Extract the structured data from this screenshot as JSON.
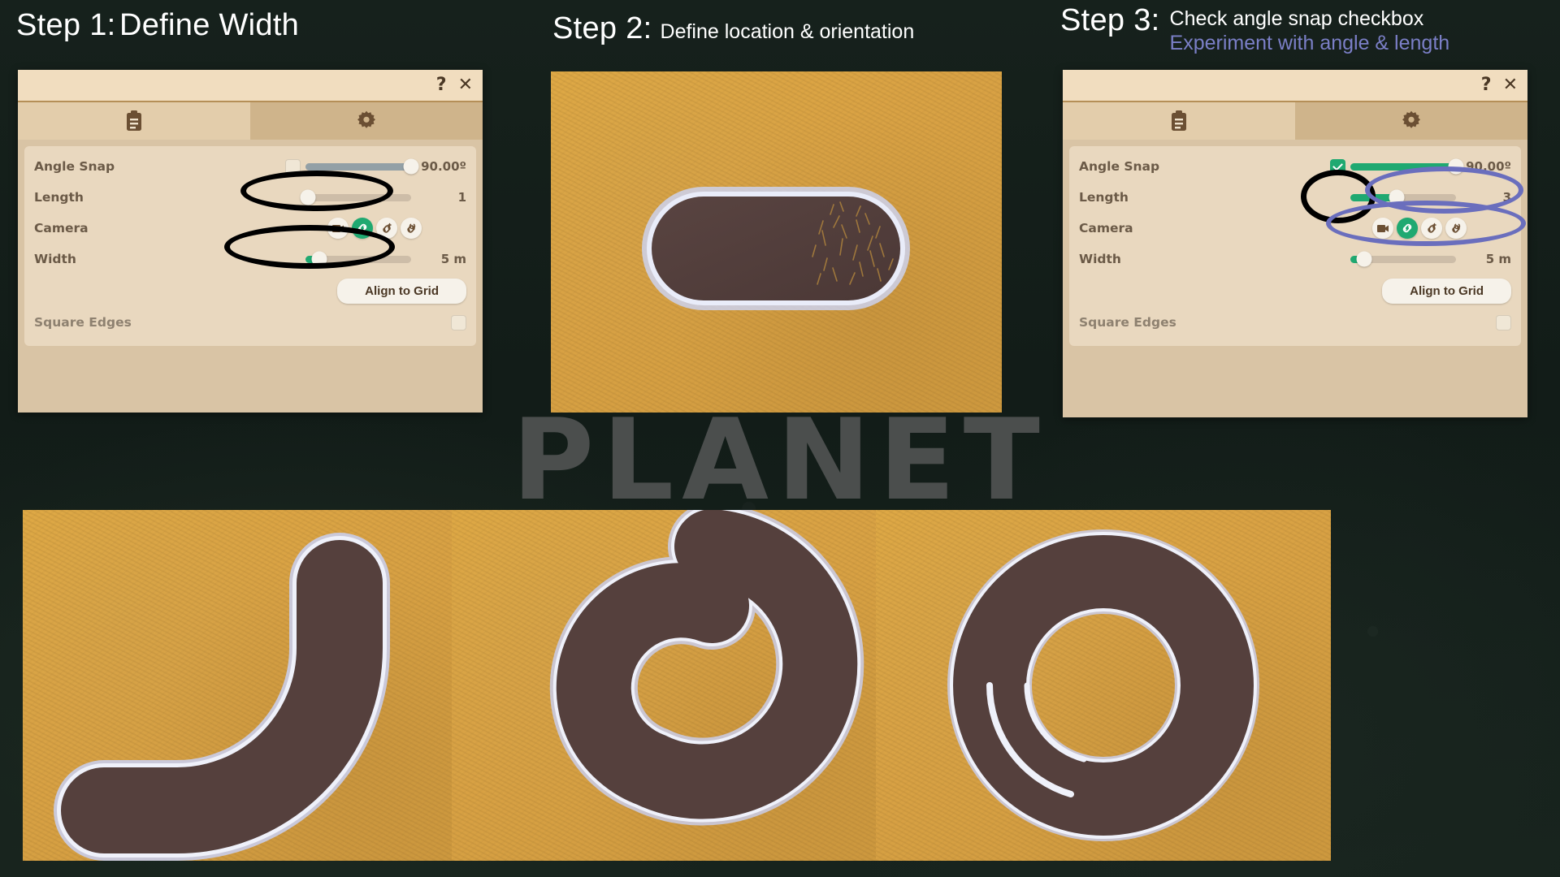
{
  "steps": [
    {
      "number": "Step 1:",
      "title": "Define Width",
      "subtitle2": ""
    },
    {
      "number": "Step 2:",
      "title": "Define location & orientation",
      "subtitle2": ""
    },
    {
      "number": "Step 3:",
      "title": "Check angle snap checkbox",
      "subtitle2": "Experiment with angle & length"
    }
  ],
  "watermark": "PLANET",
  "panel1": {
    "titlebar": {
      "help_label": "?",
      "close_label": "✕"
    },
    "tabs": [
      {
        "icon": "clipboard-icon",
        "active": false
      },
      {
        "icon": "gear-icon",
        "active": true
      }
    ],
    "rows": [
      {
        "label": "Angle Snap",
        "checkbox": false,
        "slider_pct": 100,
        "slider_style": "grey",
        "value": "90.00º"
      },
      {
        "label": "Length",
        "checkbox": null,
        "slider_pct": 2,
        "slider_style": "empty",
        "value": "1"
      },
      {
        "label": "Camera",
        "icons": [
          "camera-icon",
          "link-icon",
          "link-add-icon",
          "link-rotate-icon"
        ],
        "active_icon_index": 1
      },
      {
        "label": "Width",
        "checkbox": null,
        "slider_pct": 12,
        "slider_style": "green",
        "value": "5 m"
      }
    ],
    "align_button": "Align to Grid",
    "square_edges": {
      "label": "Square Edges",
      "checked": false
    }
  },
  "panel3": {
    "titlebar": {
      "help_label": "?",
      "close_label": "✕"
    },
    "tabs": [
      {
        "icon": "clipboard-icon",
        "active": false
      },
      {
        "icon": "gear-icon",
        "active": true
      }
    ],
    "rows": [
      {
        "label": "Angle Snap",
        "checkbox": true,
        "slider_pct": 100,
        "slider_style": "green",
        "value": "90.00º"
      },
      {
        "label": "Length",
        "checkbox": null,
        "slider_pct": 44,
        "slider_style": "green",
        "value": "3"
      },
      {
        "label": "Camera",
        "icons": [
          "camera-icon",
          "link-icon",
          "link-add-icon",
          "link-rotate-icon"
        ],
        "active_icon_index": 1
      },
      {
        "label": "Width",
        "checkbox": null,
        "slider_pct": 12,
        "slider_style": "green",
        "value": "5 m"
      }
    ],
    "align_button": "Align to Grid",
    "square_edges": {
      "label": "Square Edges",
      "checked": false
    }
  },
  "colors": {
    "terrain": "#d9a244",
    "path_dirt": "#55403d",
    "path_outline": "#b9bde4",
    "accent_green": "#1fa971",
    "annotation_black": "#000000",
    "annotation_purple": "#6a6ebd",
    "panel_bg": "#d9c4a5",
    "panel_inner": "#e9d8bf",
    "background": "#16211c"
  },
  "views": [
    {
      "name": "oval-path-preview",
      "shape": "stadium-oval"
    },
    {
      "name": "curved-path-preview",
      "shape": "quarter-arc"
    },
    {
      "name": "spiral-path-preview",
      "shape": "c-spiral"
    },
    {
      "name": "ring-path-preview",
      "shape": "full-ring"
    }
  ]
}
